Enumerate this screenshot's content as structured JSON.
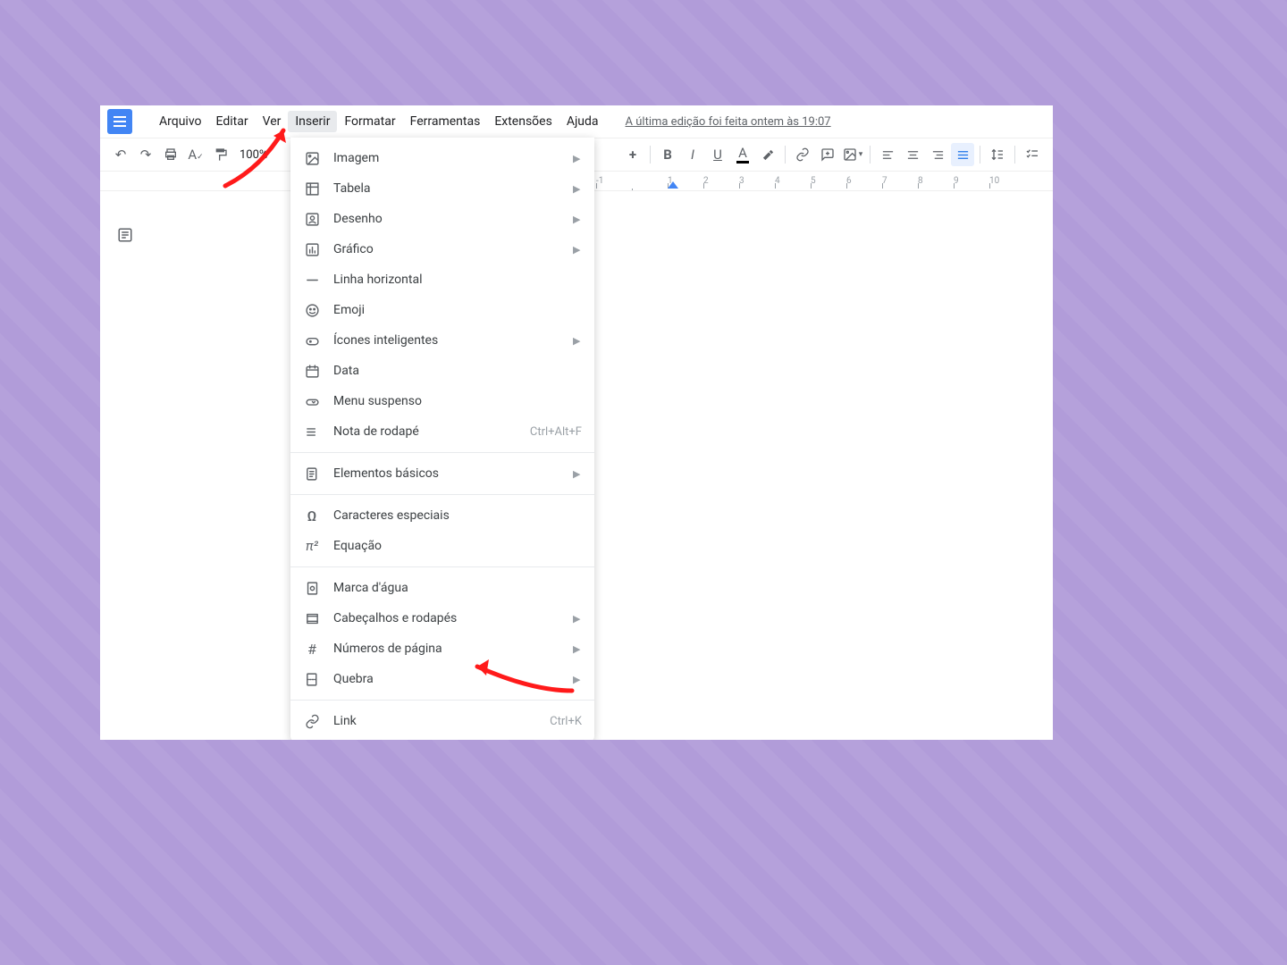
{
  "menu": {
    "items": [
      "Arquivo",
      "Editar",
      "Ver",
      "Inserir",
      "Formatar",
      "Ferramentas",
      "Extensões",
      "Ajuda"
    ],
    "active_index": 3
  },
  "last_edit": "A última edição foi feita ontem às 19:07",
  "toolbar": {
    "zoom": "100%"
  },
  "dropdown": {
    "section1": [
      {
        "icon": "image",
        "label": "Imagem",
        "has_sub": true
      },
      {
        "icon": "table",
        "label": "Tabela",
        "has_sub": true
      },
      {
        "icon": "drawing",
        "label": "Desenho",
        "has_sub": true
      },
      {
        "icon": "chart",
        "label": "Gráfico",
        "has_sub": true
      },
      {
        "icon": "hr",
        "label": "Linha horizontal"
      },
      {
        "icon": "emoji",
        "label": "Emoji"
      },
      {
        "icon": "smart",
        "label": "Ícones inteligentes",
        "has_sub": true
      },
      {
        "icon": "date",
        "label": "Data"
      },
      {
        "icon": "dropdown",
        "label": "Menu suspenso"
      },
      {
        "icon": "footnote",
        "label": "Nota de rodapé",
        "shortcut": "Ctrl+Alt+F"
      }
    ],
    "section2": [
      {
        "icon": "blocks",
        "label": "Elementos básicos",
        "has_sub": true
      }
    ],
    "section3": [
      {
        "icon": "omega",
        "label": "Caracteres especiais"
      },
      {
        "icon": "pi",
        "label": "Equação"
      }
    ],
    "section4": [
      {
        "icon": "watermark",
        "label": "Marca d'água"
      },
      {
        "icon": "headers",
        "label": "Cabeçalhos e rodapés",
        "has_sub": true
      },
      {
        "icon": "hash",
        "label": "Números de página",
        "has_sub": true
      },
      {
        "icon": "break",
        "label": "Quebra",
        "has_sub": true
      }
    ],
    "section5": [
      {
        "icon": "link",
        "label": "Link",
        "shortcut": "Ctrl+K"
      }
    ]
  },
  "ruler": {
    "ticks": [
      "-1",
      "",
      "1",
      "2",
      "3",
      "4",
      "5",
      "6",
      "7",
      "8",
      "9",
      "10"
    ]
  }
}
